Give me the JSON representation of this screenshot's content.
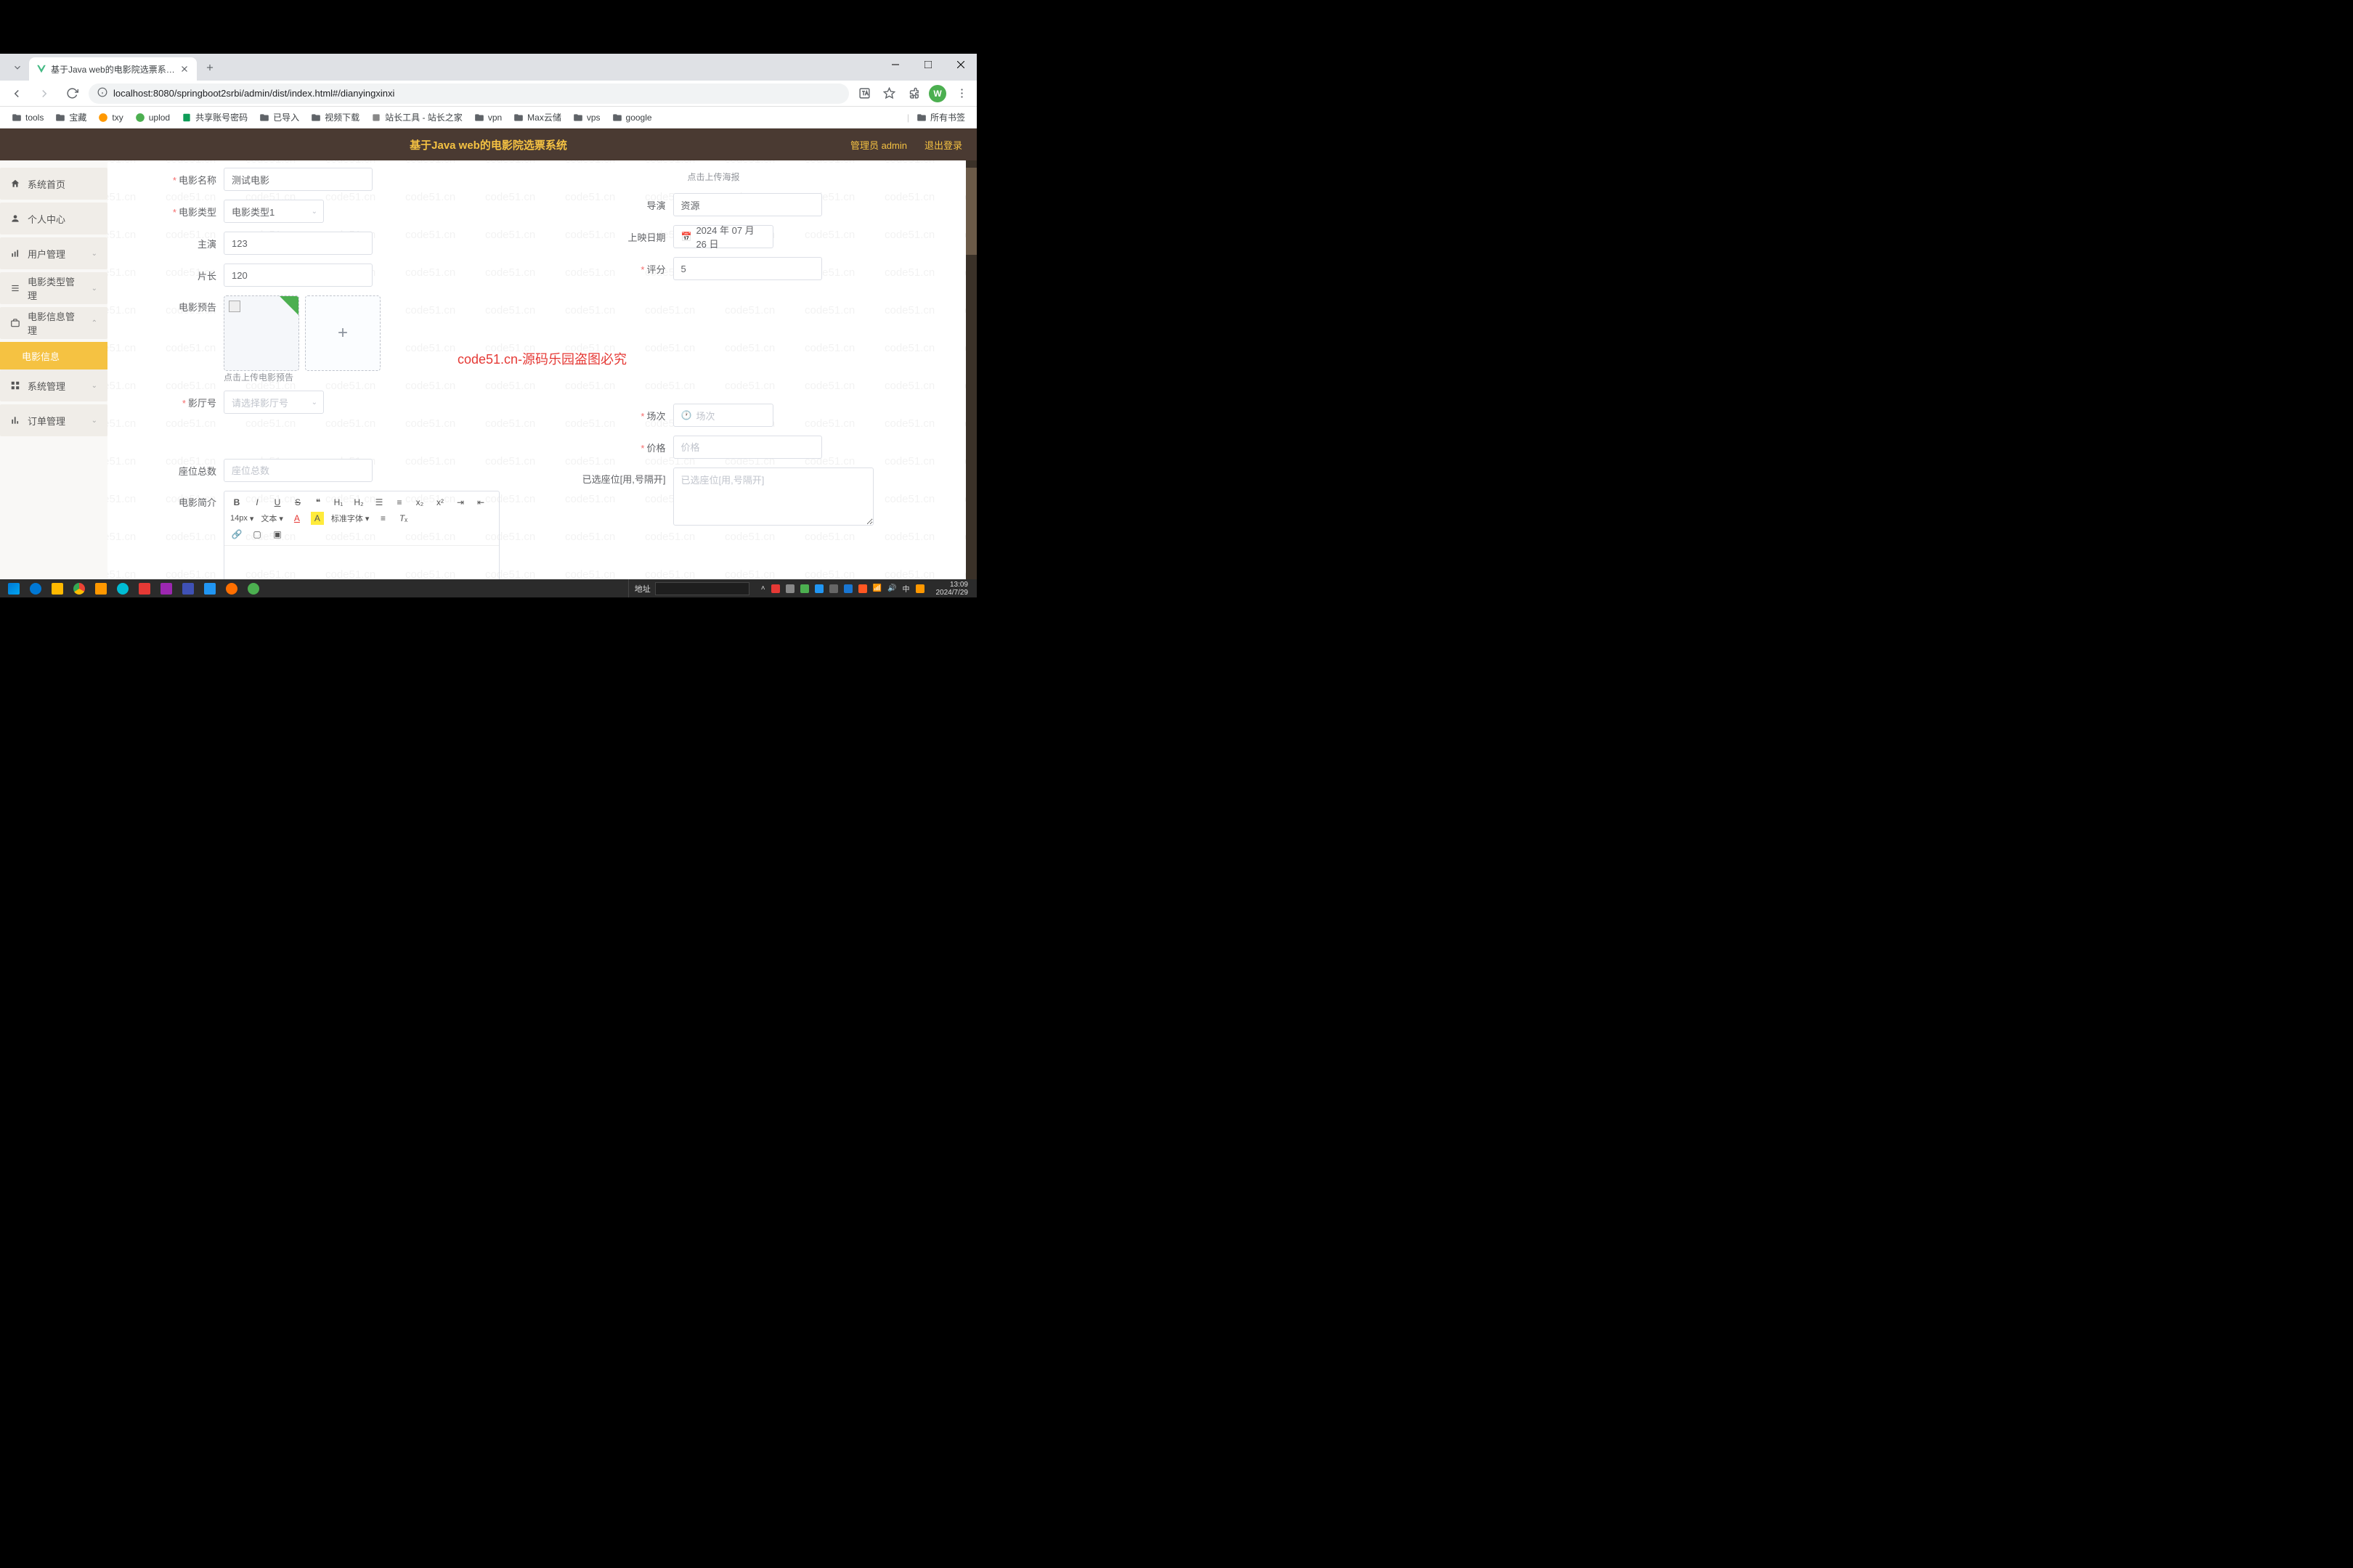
{
  "browser": {
    "tab_title": "基于Java web的电影院选票系…",
    "url": "localhost:8080/springboot2srbi/admin/dist/index.html#/dianyingxinxi",
    "bookmarks": [
      "tools",
      "宝藏",
      "txy",
      "uplod",
      "共享账号密码",
      "已导入",
      "视频下载",
      "站长工具 - 站长之家",
      "vpn",
      "Max云储",
      "vps",
      "google"
    ],
    "all_bookmarks": "所有书签",
    "win_avatar": "W"
  },
  "app": {
    "title": "基于Java web的电影院选票系统",
    "admin_label": "管理员 admin",
    "logout_label": "退出登录"
  },
  "sidebar": {
    "items": [
      {
        "label": "系统首页",
        "expandable": false
      },
      {
        "label": "个人中心",
        "expandable": false
      },
      {
        "label": "用户管理",
        "expandable": true
      },
      {
        "label": "电影类型管理",
        "expandable": true
      },
      {
        "label": "电影信息管理",
        "expandable": true,
        "expanded": true
      },
      {
        "label": "系统管理",
        "expandable": true
      },
      {
        "label": "订单管理",
        "expandable": true
      }
    ],
    "sub_active": "电影信息"
  },
  "form": {
    "movie_name": {
      "label": "电影名称",
      "value": "测试电影",
      "required": true
    },
    "movie_type": {
      "label": "电影类型",
      "value": "电影类型1",
      "required": true
    },
    "actor": {
      "label": "主演",
      "value": "123"
    },
    "duration": {
      "label": "片长",
      "value": "120"
    },
    "trailer": {
      "label": "电影预告"
    },
    "trailer_hint": "点击上传电影预告",
    "hall": {
      "label": "影厅号",
      "placeholder": "请选择影厅号",
      "required": true
    },
    "seat_total": {
      "label": "座位总数",
      "placeholder": "座位总数"
    },
    "synopsis": {
      "label": "电影简介"
    },
    "poster_hint": "点击上传海报",
    "director": {
      "label": "导演",
      "value": "资源"
    },
    "release_date": {
      "label": "上映日期",
      "value": "2024 年 07 月 26 日"
    },
    "rating": {
      "label": "评分",
      "value": "5",
      "required": true
    },
    "session": {
      "label": "场次",
      "placeholder": "场次",
      "required": true
    },
    "price": {
      "label": "价格",
      "placeholder": "价格",
      "required": true
    },
    "selected_seats": {
      "label": "已选座位[用,号隔开]",
      "placeholder": "已选座位[用,号隔开]"
    }
  },
  "editor": {
    "font_size": "14px",
    "font_style": "文本",
    "font_family": "标准字体"
  },
  "watermark": {
    "text": "code51.cn",
    "red_text": "code51.cn-源码乐园盗图必究"
  },
  "taskbar": {
    "addr_label": "地址",
    "clock_time": "13:09",
    "clock_date": "2024/7/29"
  }
}
